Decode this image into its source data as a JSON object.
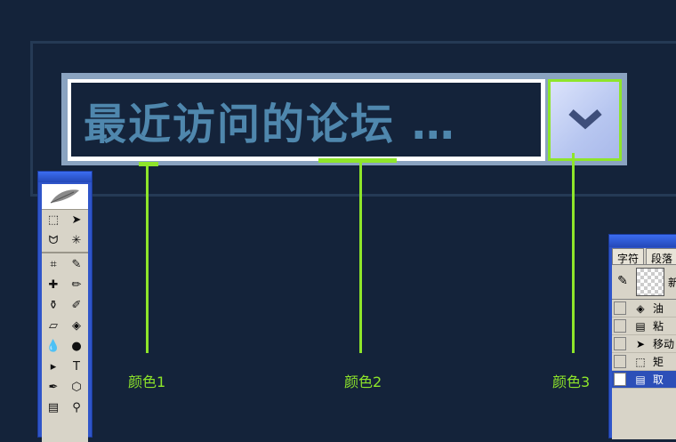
{
  "combo": {
    "text": "最近访问的论坛 …",
    "dropdown_icon": "chevron-down-icon"
  },
  "labels": {
    "color1": "颜色1",
    "color2": "颜色2",
    "color3": "颜色3"
  },
  "colors": {
    "background": "#14233a",
    "accent_green": "#8ee52a",
    "text_blue": "#4f87ad",
    "border_gray_blue": "#8aa3c0",
    "button_light": "#c3d0f4"
  },
  "toolbox": {
    "logo_icon": "feather-icon",
    "tools": [
      {
        "icon": "marquee-icon",
        "glyph": "⬚"
      },
      {
        "icon": "move-icon",
        "glyph": "➤"
      },
      {
        "icon": "lasso-icon",
        "glyph": "ᗢ"
      },
      {
        "icon": "magic-wand-icon",
        "glyph": "✳"
      },
      {
        "icon": "crop-icon",
        "glyph": "⌗"
      },
      {
        "icon": "slice-icon",
        "glyph": "✎"
      },
      {
        "icon": "healing-brush-icon",
        "glyph": "✚"
      },
      {
        "icon": "brush-icon",
        "glyph": "✏"
      },
      {
        "icon": "stamp-icon",
        "glyph": "⚱"
      },
      {
        "icon": "history-brush-icon",
        "glyph": "✐"
      },
      {
        "icon": "eraser-icon",
        "glyph": "▱"
      },
      {
        "icon": "paint-bucket-icon",
        "glyph": "◈"
      },
      {
        "icon": "blur-icon",
        "glyph": "💧"
      },
      {
        "icon": "dodge-icon",
        "glyph": "●"
      },
      {
        "icon": "path-select-icon",
        "glyph": "▸"
      },
      {
        "icon": "type-icon",
        "glyph": "T"
      },
      {
        "icon": "pen-icon",
        "glyph": "✒"
      },
      {
        "icon": "shape-icon",
        "glyph": "⬡"
      },
      {
        "icon": "notes-icon",
        "glyph": "▤"
      },
      {
        "icon": "eyedropper-icon",
        "glyph": "⚲"
      }
    ]
  },
  "panel": {
    "tabs": [
      "字符",
      "段落"
    ],
    "snapshot_label": "新",
    "history": [
      {
        "icon": "paint-bucket-icon",
        "glyph": "◈",
        "text": "油"
      },
      {
        "icon": "paste-icon",
        "glyph": "▤",
        "text": "粘"
      },
      {
        "icon": "move-icon",
        "glyph": "➤",
        "text": "移动"
      },
      {
        "icon": "marquee-icon",
        "glyph": "⬚",
        "text": "矩"
      },
      {
        "icon": "deselect-icon",
        "glyph": "▤",
        "text": "取",
        "active": true
      }
    ]
  }
}
